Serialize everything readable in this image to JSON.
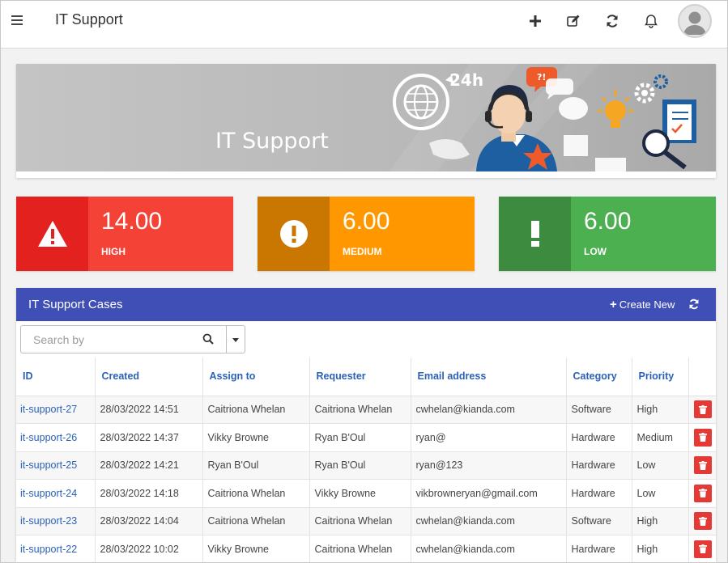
{
  "header": {
    "title": "IT Support",
    "icons": [
      "menu-icon",
      "plus-icon",
      "edit-icon",
      "refresh-icon",
      "bell-icon",
      "avatar-icon"
    ]
  },
  "banner": {
    "title": "IT Support",
    "badge_text": "24h",
    "bubble_text": "?!"
  },
  "stats": [
    {
      "value": "14.00",
      "label": "HIGH",
      "icon": "warning-triangle-icon",
      "icon_bg": "#e3211f",
      "body_bg": "#f44336"
    },
    {
      "value": "6.00",
      "label": "MEDIUM",
      "icon": "exclamation-circle-icon",
      "icon_bg": "#c97700",
      "body_bg": "#ff9800"
    },
    {
      "value": "6.00",
      "label": "LOW",
      "icon": "exclamation-icon",
      "icon_bg": "#3c8b3f",
      "body_bg": "#4caf50"
    }
  ],
  "cases": {
    "title": "IT Support Cases",
    "create_label": "Create New",
    "search_placeholder": "Search by",
    "columns": [
      "ID",
      "Created",
      "Assign to",
      "Requester",
      "Email address",
      "Category",
      "Priority"
    ],
    "rows": [
      [
        "it-support-27",
        "28/03/2022 14:51",
        "Caitriona Whelan",
        "Caitriona Whelan",
        "cwhelan@kianda.com",
        "Software",
        "High"
      ],
      [
        "it-support-26",
        "28/03/2022 14:37",
        "Vikky Browne",
        "Ryan B'Oul",
        "ryan@",
        "Hardware",
        "Medium"
      ],
      [
        "it-support-25",
        "28/03/2022 14:21",
        "Ryan B'Oul",
        "Ryan B'Oul",
        "ryan@123",
        "Hardware",
        "Low"
      ],
      [
        "it-support-24",
        "28/03/2022 14:18",
        "Caitriona Whelan",
        "Vikky Browne",
        "vikbrowneryan@gmail.com",
        "Hardware",
        "Low"
      ],
      [
        "it-support-23",
        "28/03/2022 14:04",
        "Caitriona Whelan",
        "Caitriona Whelan",
        "cwhelan@kianda.com",
        "Software",
        "High"
      ],
      [
        "it-support-22",
        "28/03/2022 10:02",
        "Vikky Browne",
        "Caitriona Whelan",
        "cwhelan@kianda.com",
        "Hardware",
        "High"
      ]
    ]
  },
  "colors": {
    "accent": "#3f4fb5",
    "link": "#2b62b7",
    "delete": "#e53935"
  }
}
